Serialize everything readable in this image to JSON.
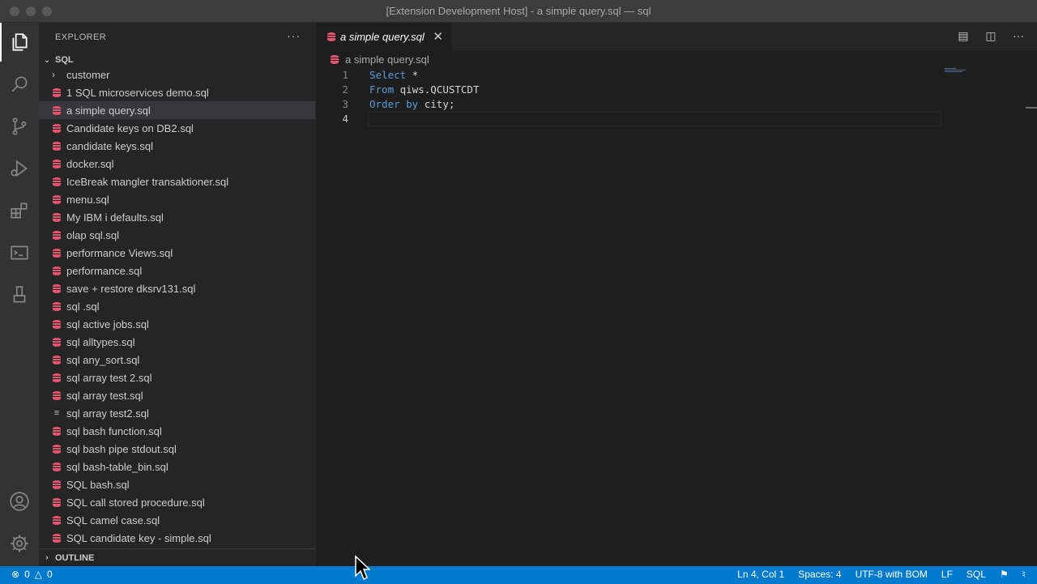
{
  "window": {
    "title": "[Extension Development Host] - a simple query.sql — sql"
  },
  "explorer": {
    "header": "EXPLORER",
    "more_label": "···",
    "section": "SQL",
    "folder": "customer",
    "files": [
      {
        "name": "1 SQL microservices demo.sql",
        "icon": "database-icon"
      },
      {
        "name": "a simple query.sql",
        "icon": "database-icon",
        "selected": true
      },
      {
        "name": "Candidate keys on DB2.sql",
        "icon": "database-icon"
      },
      {
        "name": "candidate keys.sql",
        "icon": "database-icon"
      },
      {
        "name": "docker.sql",
        "icon": "database-icon"
      },
      {
        "name": "IceBreak mangler transaktioner.sql",
        "icon": "database-icon"
      },
      {
        "name": "menu.sql",
        "icon": "database-icon"
      },
      {
        "name": "My IBM i defaults.sql",
        "icon": "database-icon"
      },
      {
        "name": "olap sql.sql",
        "icon": "database-icon"
      },
      {
        "name": "performance Views.sql",
        "icon": "database-icon"
      },
      {
        "name": "performance.sql",
        "icon": "database-icon"
      },
      {
        "name": "save + restore dksrv131.sql",
        "icon": "database-icon"
      },
      {
        "name": "sql .sql",
        "icon": "database-icon"
      },
      {
        "name": "sql active jobs.sql",
        "icon": "database-icon"
      },
      {
        "name": "sql alltypes.sql",
        "icon": "database-icon"
      },
      {
        "name": "sql any_sort.sql",
        "icon": "database-icon"
      },
      {
        "name": "sql array test 2.sql",
        "icon": "database-icon"
      },
      {
        "name": "sql array test.sql",
        "icon": "database-icon"
      },
      {
        "name": "sql array test2.sql",
        "icon": "text-lines-icon"
      },
      {
        "name": "sql bash function.sql",
        "icon": "database-icon"
      },
      {
        "name": "sql bash pipe stdout.sql",
        "icon": "database-icon"
      },
      {
        "name": "sql bash-table_bin.sql",
        "icon": "database-icon"
      },
      {
        "name": "SQL bash.sql",
        "icon": "database-icon"
      },
      {
        "name": "SQL call stored procedure.sql",
        "icon": "database-icon"
      },
      {
        "name": "SQL camel case.sql",
        "icon": "database-icon"
      },
      {
        "name": "SQL candidate key - simple.sql",
        "icon": "database-icon"
      }
    ],
    "outline": "OUTLINE"
  },
  "editor": {
    "tab_label": "a simple query.sql",
    "breadcrumb": "a simple query.sql",
    "lines": [
      {
        "num": "1",
        "kw": "Select",
        "rest": " *"
      },
      {
        "num": "2",
        "kw": "From",
        "rest": " qiws.QCUSTCDT"
      },
      {
        "num": "3",
        "kw": "Order by",
        "rest": " city;"
      },
      {
        "num": "4",
        "kw": "",
        "rest": ""
      }
    ]
  },
  "statusbar": {
    "errors": "0",
    "warnings": "0",
    "position": "Ln 4, Col 1",
    "spaces": "Spaces: 4",
    "encoding": "UTF-8 with BOM",
    "eol": "LF",
    "language": "SQL"
  },
  "colors": {
    "accent": "#007acc",
    "db_icon": "#e5536e",
    "keyword": "#569cd6"
  }
}
